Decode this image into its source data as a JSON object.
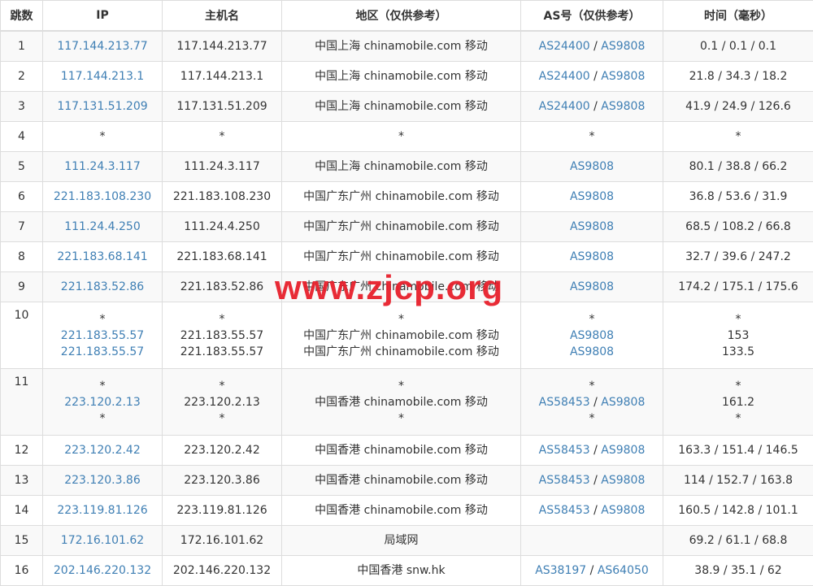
{
  "headers": [
    "跳数",
    "IP",
    "主机名",
    "地区（仅供参考）",
    "AS号（仅供参考）",
    "时间（毫秒）"
  ],
  "rows": [
    {
      "hop": "1",
      "lines": [
        {
          "ip": "117.144.213.77",
          "host": "117.144.213.77",
          "region": "中国上海 chinamobile.com 移动",
          "as": [
            "AS24400",
            "AS9808"
          ],
          "time": "0.1 / 0.1 / 0.1"
        }
      ]
    },
    {
      "hop": "2",
      "lines": [
        {
          "ip": "117.144.213.1",
          "host": "117.144.213.1",
          "region": "中国上海 chinamobile.com 移动",
          "as": [
            "AS24400",
            "AS9808"
          ],
          "time": "21.8 / 34.3 / 18.2"
        }
      ]
    },
    {
      "hop": "3",
      "lines": [
        {
          "ip": "117.131.51.209",
          "host": "117.131.51.209",
          "region": "中国上海 chinamobile.com 移动",
          "as": [
            "AS24400",
            "AS9808"
          ],
          "time": "41.9 / 24.9 / 126.6"
        }
      ]
    },
    {
      "hop": "4",
      "lines": [
        {
          "ip": "*",
          "host": "*",
          "region": "*",
          "as": [
            "*"
          ],
          "time": "*"
        }
      ]
    },
    {
      "hop": "5",
      "lines": [
        {
          "ip": "111.24.3.117",
          "host": "111.24.3.117",
          "region": "中国上海 chinamobile.com 移动",
          "as": [
            "AS9808"
          ],
          "time": "80.1 / 38.8 / 66.2"
        }
      ]
    },
    {
      "hop": "6",
      "lines": [
        {
          "ip": "221.183.108.230",
          "host": "221.183.108.230",
          "region": "中国广东广州 chinamobile.com 移动",
          "as": [
            "AS9808"
          ],
          "time": "36.8 / 53.6 / 31.9"
        }
      ]
    },
    {
      "hop": "7",
      "lines": [
        {
          "ip": "111.24.4.250",
          "host": "111.24.4.250",
          "region": "中国广东广州 chinamobile.com 移动",
          "as": [
            "AS9808"
          ],
          "time": "68.5 / 108.2 / 66.8"
        }
      ]
    },
    {
      "hop": "8",
      "lines": [
        {
          "ip": "221.183.68.141",
          "host": "221.183.68.141",
          "region": "中国广东广州 chinamobile.com 移动",
          "as": [
            "AS9808"
          ],
          "time": "32.7 / 39.6 / 247.2"
        }
      ]
    },
    {
      "hop": "9",
      "lines": [
        {
          "ip": "221.183.52.86",
          "host": "221.183.52.86",
          "region": "中国广东广州 chinamobile.com 移动",
          "as": [
            "AS9808"
          ],
          "time": "174.2 / 175.1 / 175.6"
        }
      ]
    },
    {
      "hop": "10",
      "lines": [
        {
          "ip": "*",
          "host": "*",
          "region": "*",
          "as": [
            "*"
          ],
          "time": "*"
        },
        {
          "ip": "221.183.55.57",
          "host": "221.183.55.57",
          "region": "中国广东广州 chinamobile.com 移动",
          "as": [
            "AS9808"
          ],
          "time": "153"
        },
        {
          "ip": "221.183.55.57",
          "host": "221.183.55.57",
          "region": "中国广东广州 chinamobile.com 移动",
          "as": [
            "AS9808"
          ],
          "time": "133.5"
        }
      ]
    },
    {
      "hop": "11",
      "lines": [
        {
          "ip": "*",
          "host": "*",
          "region": "*",
          "as": [
            "*"
          ],
          "time": "*"
        },
        {
          "ip": "223.120.2.13",
          "host": "223.120.2.13",
          "region": "中国香港 chinamobile.com 移动",
          "as": [
            "AS58453",
            "AS9808"
          ],
          "time": "161.2"
        },
        {
          "ip": "*",
          "host": "*",
          "region": "*",
          "as": [
            "*"
          ],
          "time": "*"
        }
      ]
    },
    {
      "hop": "12",
      "lines": [
        {
          "ip": "223.120.2.42",
          "host": "223.120.2.42",
          "region": "中国香港 chinamobile.com 移动",
          "as": [
            "AS58453",
            "AS9808"
          ],
          "time": "163.3 / 151.4 / 146.5"
        }
      ]
    },
    {
      "hop": "13",
      "lines": [
        {
          "ip": "223.120.3.86",
          "host": "223.120.3.86",
          "region": "中国香港 chinamobile.com 移动",
          "as": [
            "AS58453",
            "AS9808"
          ],
          "time": "114 / 152.7 / 163.8"
        }
      ]
    },
    {
      "hop": "14",
      "lines": [
        {
          "ip": "223.119.81.126",
          "host": "223.119.81.126",
          "region": "中国香港 chinamobile.com 移动",
          "as": [
            "AS58453",
            "AS9808"
          ],
          "time": "160.5 / 142.8 / 101.1"
        }
      ]
    },
    {
      "hop": "15",
      "lines": [
        {
          "ip": "172.16.101.62",
          "host": "172.16.101.62",
          "region": "局域网",
          "as": [],
          "time": "69.2 / 61.1 / 68.8"
        }
      ]
    },
    {
      "hop": "16",
      "lines": [
        {
          "ip": "202.146.220.132",
          "host": "202.146.220.132",
          "region": "中国香港 snw.hk",
          "as": [
            "AS38197",
            "AS64050"
          ],
          "time": "38.9 / 35.1 / 62"
        }
      ]
    }
  ],
  "as_separator": " / ",
  "watermark": "www.zjcp.org",
  "colors": {
    "link": "#3f7fb4",
    "watermark": "#e8202c",
    "row_alt": "#f9f9f9",
    "border": "#dddddd"
  }
}
